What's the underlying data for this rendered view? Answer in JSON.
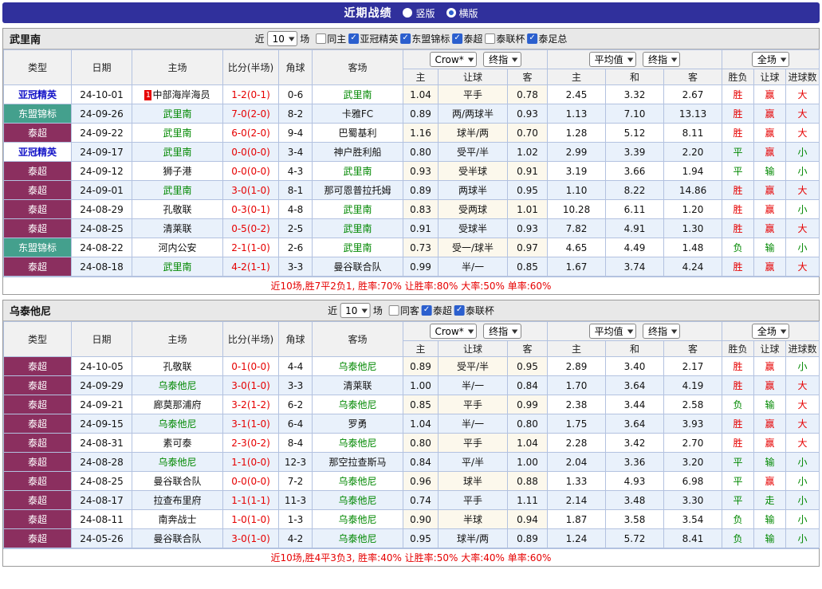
{
  "topbar": {
    "title": "近期战绩",
    "radios": [
      {
        "label": "竖版",
        "selected": false
      },
      {
        "label": "横版",
        "selected": true
      }
    ]
  },
  "icons": {
    "chevron_down": "▼",
    "check": "✓"
  },
  "colors": {
    "topbar_bg": "#30309c",
    "radio_blue": "#2b5fce",
    "checkbox_blue": "#2b5fce",
    "section_header_bg": "#e8e8e8",
    "head_bg": "#f1f1f1",
    "grid": "#b3c2e0",
    "row_alt": "#e9f1fb",
    "crow_tint": "#fcf8ec",
    "red": "#e60000",
    "green": "#008800",
    "acl_text": "#1515c8",
    "asean_bg": "#44a08d",
    "thai_bg": "#8b2f5f"
  },
  "table_header": {
    "cols": [
      "类型",
      "日期",
      "主场",
      "比分(半场)",
      "角球",
      "客场"
    ],
    "odds_selects": [
      "Crow*",
      "终指"
    ],
    "avg_selects": [
      "平均值",
      "终指"
    ],
    "scope_selects": [
      "全场"
    ],
    "sub": [
      "主",
      "让球",
      "客",
      "主",
      "和",
      "客",
      "胜负",
      "让球",
      "进球数"
    ]
  },
  "sections": [
    {
      "team": "武里南",
      "filter": {
        "near_label": "近",
        "count": "10",
        "games_label": "场",
        "checkboxes": [
          {
            "label": "同主",
            "checked": false
          },
          {
            "label": "亚冠精英",
            "checked": true
          },
          {
            "label": "东盟锦标",
            "checked": true
          },
          {
            "label": "泰超",
            "checked": true
          },
          {
            "label": "泰联杯",
            "checked": false
          },
          {
            "label": "泰足总",
            "checked": true
          }
        ]
      },
      "rows": [
        {
          "type": "亚冠精英",
          "type_class": "acl",
          "date": "24-10-01",
          "home": "中部海岸海员",
          "home_green": false,
          "home_badge": "1",
          "score": "1-2(0-1)",
          "corner": "0-6",
          "away": "武里南",
          "away_green": true,
          "odds": [
            "1.04",
            "平手",
            "0.78"
          ],
          "avg": [
            "2.45",
            "3.32",
            "2.67"
          ],
          "result": [
            {
              "t": "胜",
              "c": "r"
            },
            {
              "t": "赢",
              "c": "r"
            },
            {
              "t": "大",
              "c": "r"
            }
          ]
        },
        {
          "type": "东盟锦标",
          "type_class": "asean",
          "date": "24-09-26",
          "home": "武里南",
          "home_green": true,
          "score": "7-0(2-0)",
          "corner": "8-2",
          "away": "卡雅FC",
          "away_green": false,
          "odds": [
            "0.89",
            "两/两球半",
            "0.93"
          ],
          "avg": [
            "1.13",
            "7.10",
            "13.13"
          ],
          "result": [
            {
              "t": "胜",
              "c": "r"
            },
            {
              "t": "赢",
              "c": "r"
            },
            {
              "t": "大",
              "c": "r"
            }
          ]
        },
        {
          "type": "泰超",
          "type_class": "thai",
          "date": "24-09-22",
          "home": "武里南",
          "home_green": true,
          "score": "6-0(2-0)",
          "corner": "9-4",
          "away": "巴蜀基利",
          "away_green": false,
          "odds": [
            "1.16",
            "球半/两",
            "0.70"
          ],
          "avg": [
            "1.28",
            "5.12",
            "8.11"
          ],
          "result": [
            {
              "t": "胜",
              "c": "r"
            },
            {
              "t": "赢",
              "c": "r"
            },
            {
              "t": "大",
              "c": "r"
            }
          ]
        },
        {
          "type": "亚冠精英",
          "type_class": "acl",
          "date": "24-09-17",
          "home": "武里南",
          "home_green": true,
          "score": "0-0(0-0)",
          "corner": "3-4",
          "away": "神户胜利船",
          "away_green": false,
          "odds": [
            "0.80",
            "受平/半",
            "1.02"
          ],
          "avg": [
            "2.99",
            "3.39",
            "2.20"
          ],
          "result": [
            {
              "t": "平",
              "c": "g"
            },
            {
              "t": "赢",
              "c": "r"
            },
            {
              "t": "小",
              "c": "g"
            }
          ]
        },
        {
          "type": "泰超",
          "type_class": "thai",
          "date": "24-09-12",
          "home": "狮子港",
          "home_green": false,
          "score": "0-0(0-0)",
          "corner": "4-3",
          "away": "武里南",
          "away_green": true,
          "odds": [
            "0.93",
            "受半球",
            "0.91"
          ],
          "avg": [
            "3.19",
            "3.66",
            "1.94"
          ],
          "result": [
            {
              "t": "平",
              "c": "g"
            },
            {
              "t": "输",
              "c": "g"
            },
            {
              "t": "小",
              "c": "g"
            }
          ]
        },
        {
          "type": "泰超",
          "type_class": "thai",
          "date": "24-09-01",
          "home": "武里南",
          "home_green": true,
          "score": "3-0(1-0)",
          "corner": "8-1",
          "away": "那可恩普拉托姆",
          "away_green": false,
          "odds": [
            "0.89",
            "两球半",
            "0.95"
          ],
          "avg": [
            "1.10",
            "8.22",
            "14.86"
          ],
          "result": [
            {
              "t": "胜",
              "c": "r"
            },
            {
              "t": "赢",
              "c": "r"
            },
            {
              "t": "大",
              "c": "r"
            }
          ]
        },
        {
          "type": "泰超",
          "type_class": "thai",
          "date": "24-08-29",
          "home": "孔敬联",
          "home_green": false,
          "score": "0-3(0-1)",
          "corner": "4-8",
          "away": "武里南",
          "away_green": true,
          "odds": [
            "0.83",
            "受两球",
            "1.01"
          ],
          "avg": [
            "10.28",
            "6.11",
            "1.20"
          ],
          "result": [
            {
              "t": "胜",
              "c": "r"
            },
            {
              "t": "赢",
              "c": "r"
            },
            {
              "t": "小",
              "c": "g"
            }
          ]
        },
        {
          "type": "泰超",
          "type_class": "thai",
          "date": "24-08-25",
          "home": "清莱联",
          "home_green": false,
          "score": "0-5(0-2)",
          "corner": "2-5",
          "away": "武里南",
          "away_green": true,
          "odds": [
            "0.91",
            "受球半",
            "0.93"
          ],
          "avg": [
            "7.82",
            "4.91",
            "1.30"
          ],
          "result": [
            {
              "t": "胜",
              "c": "r"
            },
            {
              "t": "赢",
              "c": "r"
            },
            {
              "t": "大",
              "c": "r"
            }
          ]
        },
        {
          "type": "东盟锦标",
          "type_class": "asean",
          "date": "24-08-22",
          "home": "河内公安",
          "home_green": false,
          "score": "2-1(1-0)",
          "corner": "2-6",
          "away": "武里南",
          "away_green": true,
          "odds": [
            "0.73",
            "受一/球半",
            "0.97"
          ],
          "avg": [
            "4.65",
            "4.49",
            "1.48"
          ],
          "result": [
            {
              "t": "负",
              "c": "g"
            },
            {
              "t": "输",
              "c": "g"
            },
            {
              "t": "小",
              "c": "g"
            }
          ]
        },
        {
          "type": "泰超",
          "type_class": "thai",
          "date": "24-08-18",
          "home": "武里南",
          "home_green": true,
          "score": "4-2(1-1)",
          "corner": "3-3",
          "away": "曼谷联合队",
          "away_green": false,
          "odds": [
            "0.99",
            "半/一",
            "0.85"
          ],
          "avg": [
            "1.67",
            "3.74",
            "4.24"
          ],
          "result": [
            {
              "t": "胜",
              "c": "r"
            },
            {
              "t": "赢",
              "c": "r"
            },
            {
              "t": "大",
              "c": "r"
            }
          ]
        }
      ],
      "summary": "近10场,胜7平2负1, 胜率:70% 让胜率:80% 大率:50% 单率:60%"
    },
    {
      "team": "乌泰他尼",
      "filter": {
        "near_label": "近",
        "count": "10",
        "games_label": "场",
        "checkboxes": [
          {
            "label": "同客",
            "checked": false
          },
          {
            "label": "泰超",
            "checked": true
          },
          {
            "label": "泰联杯",
            "checked": true
          }
        ]
      },
      "rows": [
        {
          "type": "泰超",
          "type_class": "thai",
          "date": "24-10-05",
          "home": "孔敬联",
          "home_green": false,
          "score": "0-1(0-0)",
          "corner": "4-4",
          "away": "乌泰他尼",
          "away_green": true,
          "odds": [
            "0.89",
            "受平/半",
            "0.95"
          ],
          "avg": [
            "2.89",
            "3.40",
            "2.17"
          ],
          "result": [
            {
              "t": "胜",
              "c": "r"
            },
            {
              "t": "赢",
              "c": "r"
            },
            {
              "t": "小",
              "c": "g"
            }
          ]
        },
        {
          "type": "泰超",
          "type_class": "thai",
          "date": "24-09-29",
          "home": "乌泰他尼",
          "home_green": true,
          "score": "3-0(1-0)",
          "corner": "3-3",
          "away": "清莱联",
          "away_green": false,
          "odds": [
            "1.00",
            "半/一",
            "0.84"
          ],
          "avg": [
            "1.70",
            "3.64",
            "4.19"
          ],
          "result": [
            {
              "t": "胜",
              "c": "r"
            },
            {
              "t": "赢",
              "c": "r"
            },
            {
              "t": "大",
              "c": "r"
            }
          ]
        },
        {
          "type": "泰超",
          "type_class": "thai",
          "date": "24-09-21",
          "home": "廊莫那浦府",
          "home_green": false,
          "score": "3-2(1-2)",
          "corner": "6-2",
          "away": "乌泰他尼",
          "away_green": true,
          "odds": [
            "0.85",
            "平手",
            "0.99"
          ],
          "avg": [
            "2.38",
            "3.44",
            "2.58"
          ],
          "result": [
            {
              "t": "负",
              "c": "g"
            },
            {
              "t": "输",
              "c": "g"
            },
            {
              "t": "大",
              "c": "r"
            }
          ]
        },
        {
          "type": "泰超",
          "type_class": "thai",
          "date": "24-09-15",
          "home": "乌泰他尼",
          "home_green": true,
          "score": "3-1(1-0)",
          "corner": "6-4",
          "away": "罗勇",
          "away_green": false,
          "odds": [
            "1.04",
            "半/一",
            "0.80"
          ],
          "avg": [
            "1.75",
            "3.64",
            "3.93"
          ],
          "result": [
            {
              "t": "胜",
              "c": "r"
            },
            {
              "t": "赢",
              "c": "r"
            },
            {
              "t": "大",
              "c": "r"
            }
          ]
        },
        {
          "type": "泰超",
          "type_class": "thai",
          "date": "24-08-31",
          "home": "素可泰",
          "home_green": false,
          "score": "2-3(0-2)",
          "corner": "8-4",
          "away": "乌泰他尼",
          "away_green": true,
          "odds": [
            "0.80",
            "平手",
            "1.04"
          ],
          "avg": [
            "2.28",
            "3.42",
            "2.70"
          ],
          "result": [
            {
              "t": "胜",
              "c": "r"
            },
            {
              "t": "赢",
              "c": "r"
            },
            {
              "t": "大",
              "c": "r"
            }
          ]
        },
        {
          "type": "泰超",
          "type_class": "thai",
          "date": "24-08-28",
          "home": "乌泰他尼",
          "home_green": true,
          "score": "1-1(0-0)",
          "corner": "12-3",
          "away": "那空拉查斯马",
          "away_green": false,
          "odds": [
            "0.84",
            "平/半",
            "1.00"
          ],
          "avg": [
            "2.04",
            "3.36",
            "3.20"
          ],
          "result": [
            {
              "t": "平",
              "c": "g"
            },
            {
              "t": "输",
              "c": "g"
            },
            {
              "t": "小",
              "c": "g"
            }
          ]
        },
        {
          "type": "泰超",
          "type_class": "thai",
          "date": "24-08-25",
          "home": "曼谷联合队",
          "home_green": false,
          "score": "0-0(0-0)",
          "corner": "7-2",
          "away": "乌泰他尼",
          "away_green": true,
          "odds": [
            "0.96",
            "球半",
            "0.88"
          ],
          "avg": [
            "1.33",
            "4.93",
            "6.98"
          ],
          "result": [
            {
              "t": "平",
              "c": "g"
            },
            {
              "t": "赢",
              "c": "r"
            },
            {
              "t": "小",
              "c": "g"
            }
          ]
        },
        {
          "type": "泰超",
          "type_class": "thai",
          "date": "24-08-17",
          "home": "拉查布里府",
          "home_green": false,
          "score": "1-1(1-1)",
          "corner": "11-3",
          "away": "乌泰他尼",
          "away_green": true,
          "odds": [
            "0.74",
            "平手",
            "1.11"
          ],
          "avg": [
            "2.14",
            "3.48",
            "3.30"
          ],
          "result": [
            {
              "t": "平",
              "c": "g"
            },
            {
              "t": "走",
              "c": "g"
            },
            {
              "t": "小",
              "c": "g"
            }
          ]
        },
        {
          "type": "泰超",
          "type_class": "thai",
          "date": "24-08-11",
          "home": "南奔战士",
          "home_green": false,
          "score": "1-0(1-0)",
          "corner": "1-3",
          "away": "乌泰他尼",
          "away_green": true,
          "odds": [
            "0.90",
            "半球",
            "0.94"
          ],
          "avg": [
            "1.87",
            "3.58",
            "3.54"
          ],
          "result": [
            {
              "t": "负",
              "c": "g"
            },
            {
              "t": "输",
              "c": "g"
            },
            {
              "t": "小",
              "c": "g"
            }
          ]
        },
        {
          "type": "泰超",
          "type_class": "thai",
          "date": "24-05-26",
          "home": "曼谷联合队",
          "home_green": false,
          "score": "3-0(1-0)",
          "corner": "4-2",
          "away": "乌泰他尼",
          "away_green": true,
          "odds": [
            "0.95",
            "球半/两",
            "0.89"
          ],
          "avg": [
            "1.24",
            "5.72",
            "8.41"
          ],
          "result": [
            {
              "t": "负",
              "c": "g"
            },
            {
              "t": "输",
              "c": "g"
            },
            {
              "t": "小",
              "c": "g"
            }
          ]
        }
      ],
      "summary": "近10场,胜4平3负3, 胜率:40% 让胜率:50% 大率:40% 单率:60%"
    }
  ]
}
